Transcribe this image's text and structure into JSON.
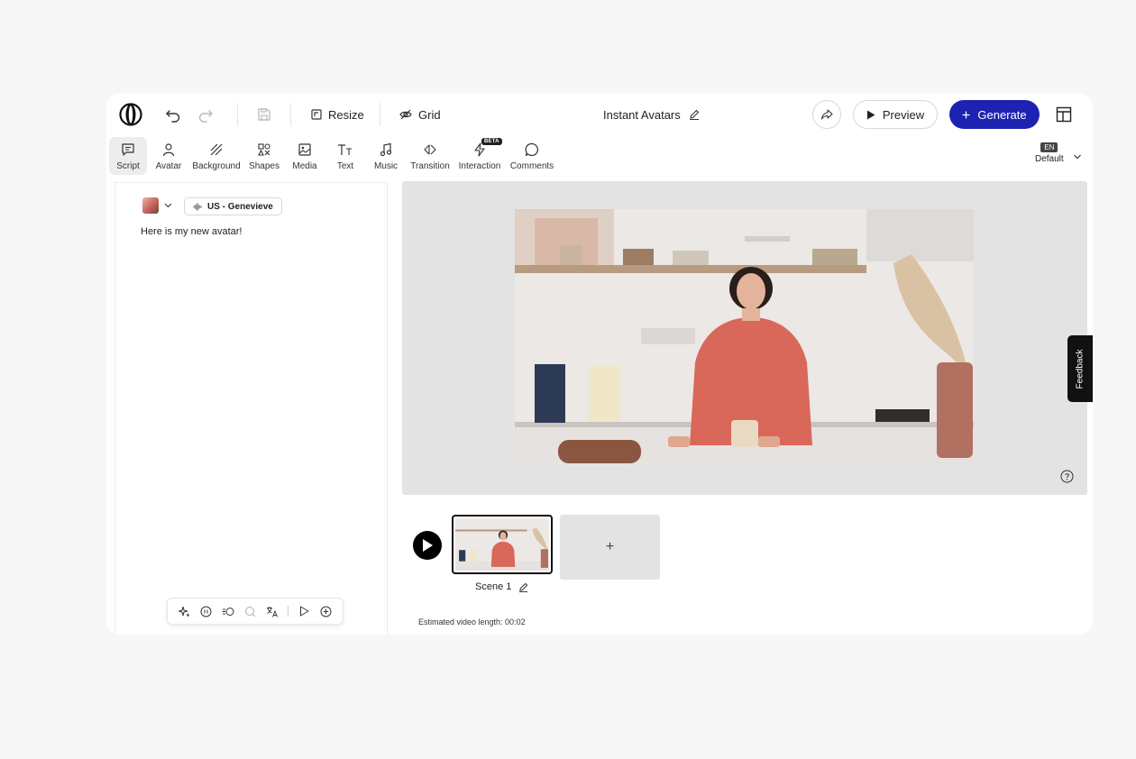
{
  "topbar": {
    "resize_label": "Resize",
    "grid_label": "Grid",
    "project_title": "Instant Avatars",
    "preview_label": "Preview",
    "generate_label": "Generate"
  },
  "toolbar": {
    "items": [
      {
        "label": "Script",
        "icon": "script-icon"
      },
      {
        "label": "Avatar",
        "icon": "avatar-icon"
      },
      {
        "label": "Background",
        "icon": "background-icon"
      },
      {
        "label": "Shapes",
        "icon": "shapes-icon"
      },
      {
        "label": "Media",
        "icon": "media-icon"
      },
      {
        "label": "Text",
        "icon": "text-icon"
      },
      {
        "label": "Music",
        "icon": "music-icon"
      },
      {
        "label": "Transition",
        "icon": "transition-icon"
      },
      {
        "label": "Interaction",
        "icon": "interaction-icon"
      },
      {
        "label": "Comments",
        "icon": "comments-icon"
      }
    ],
    "beta_badge": "BETA",
    "language_code": "EN",
    "language_label": "Default"
  },
  "script_panel": {
    "voice_label": "US - Genevieve",
    "script_text": "Here is my new avatar!"
  },
  "feedback_label": "Feedback",
  "timeline": {
    "scene_label": "Scene 1",
    "add_scene_label": "+",
    "estimated_length": "Estimated video length: 00:02"
  },
  "colors": {
    "accent": "#1e22b3",
    "background": "#f7f7f7",
    "stage": "#e3e3e3"
  }
}
